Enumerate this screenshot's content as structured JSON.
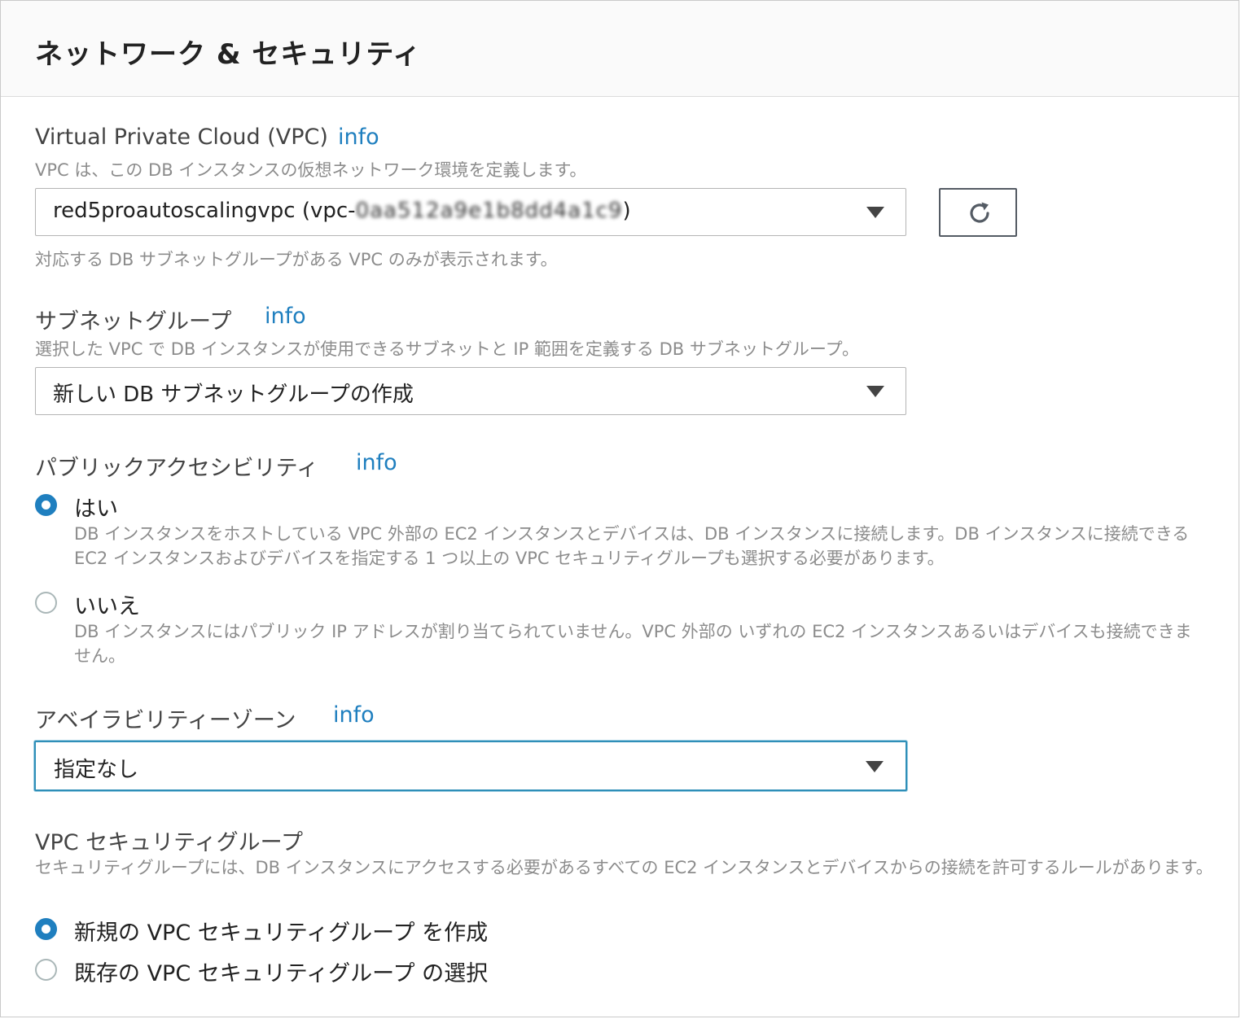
{
  "section": {
    "title": "ネットワーク & セキュリティ"
  },
  "vpc": {
    "label": "Virtual Private Cloud (VPC)",
    "info": "info",
    "description": "VPC は、この DB インスタンスの仮想ネットワーク環境を定義します。",
    "selected_prefix": "red5proautoscalingvpc (vpc-",
    "selected_redacted": "0aa512a9e1b8dd4a1c9",
    "selected_suffix": ")",
    "note": "対応する DB サブネットグループがある VPC のみが表示されます。",
    "refresh_icon": "refresh-icon"
  },
  "subnet_group": {
    "label": "サブネットグループ",
    "info": "info",
    "description": "選択した VPC で DB インスタンスが使用できるサブネットと IP 範囲を定義する DB サブネットグループ。",
    "selected": "新しい DB サブネットグループの作成"
  },
  "public_access": {
    "label": "パブリックアクセシビリティ",
    "info": "info",
    "options": [
      {
        "label": "はい",
        "checked": true,
        "description": "DB インスタンスをホストしている VPC 外部の EC2 インスタンスとデバイスは、DB インスタンスに接続します。DB インスタンスに接続できる EC2 インスタンスおよびデバイスを指定する 1 つ以上の VPC セキュリティグループも選択する必要があります。"
      },
      {
        "label": "いいえ",
        "checked": false,
        "description": "DB インスタンスにはパブリック IP アドレスが割り当てられていません。VPC 外部の いずれの EC2 インスタンスあるいはデバイスも接続できません。"
      }
    ]
  },
  "availability_zone": {
    "label": "アベイラビリティーゾーン",
    "info": "info",
    "selected": "指定なし"
  },
  "security_group": {
    "label": "VPC セキュリティグループ",
    "description": "セキュリティグループには、DB インスタンスにアクセスする必要があるすべての EC2 インスタンスとデバイスからの接続を許可するルールがあります。",
    "options": [
      {
        "label": "新規の VPC セキュリティグループ を作成",
        "checked": true
      },
      {
        "label": "既存の VPC セキュリティグループ の選択",
        "checked": false
      }
    ]
  },
  "colors": {
    "accent": "#1f7fbf",
    "focus_border": "#2f8fb8",
    "header_bg": "#fafafa",
    "description_text": "#8c8c8c"
  }
}
